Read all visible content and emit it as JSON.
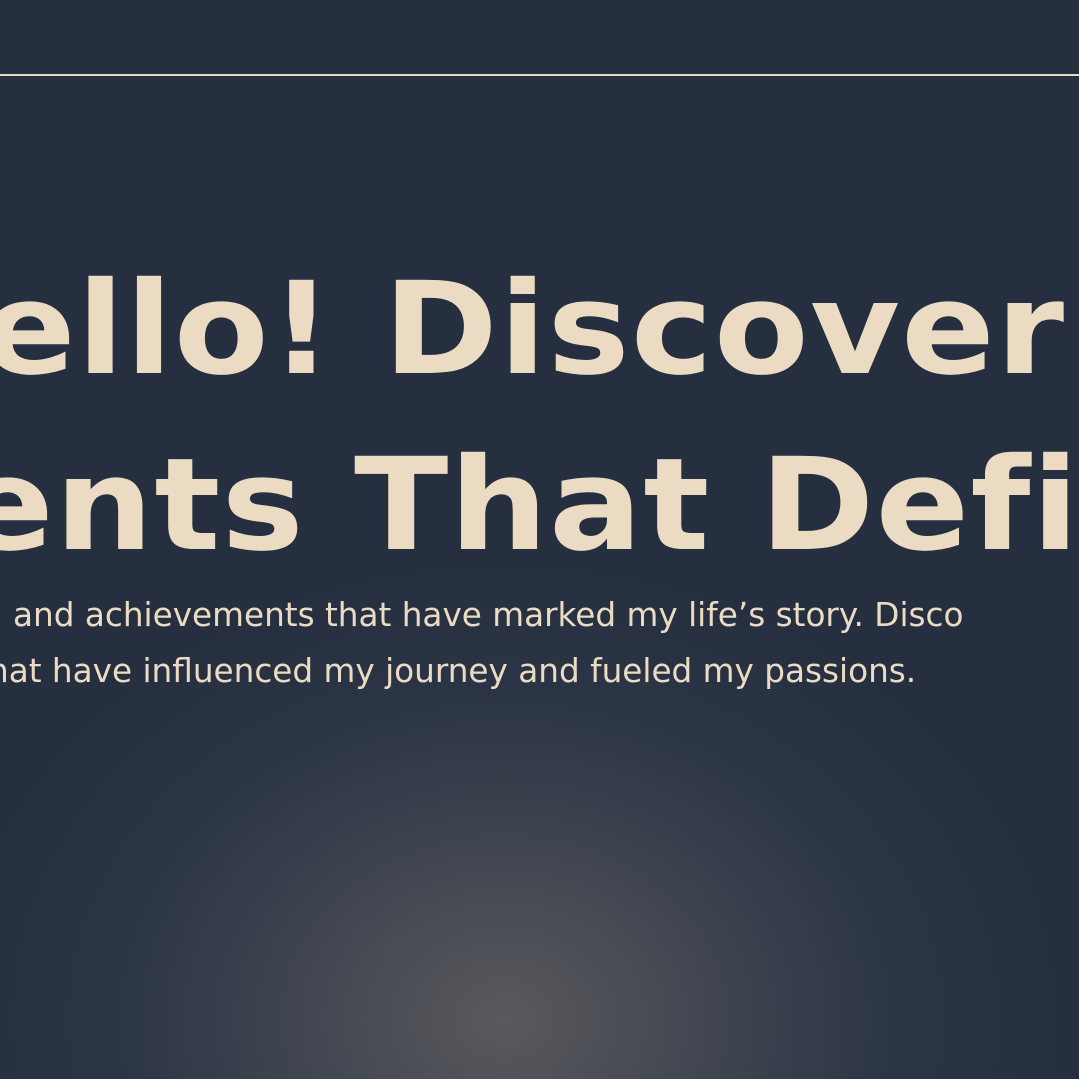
{
  "hero": {
    "headline_line_1": "ello! Discover th",
    "headline_line_2": "ents That Defin",
    "subtext_line_1": " and achievements that have marked my life’s story. Disco",
    "subtext_line_2": "hat have influenced my journey and fueled my passions."
  },
  "colors": {
    "background": "#252f40",
    "text": "#ebdbc3",
    "rule": "#e9d9c3",
    "glow": "#5c5c5e"
  }
}
